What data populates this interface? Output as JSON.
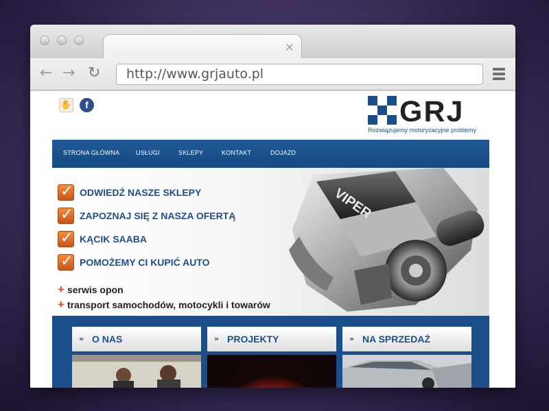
{
  "browser": {
    "tab_close": "×",
    "back": "←",
    "forward": "→",
    "reload": "↻",
    "url": "http://www.grjauto.pl"
  },
  "site": {
    "logo_text": "GRJ",
    "logo_tagline": "Rozwiązujemy motoryzacyjne problemy",
    "social": {
      "hand": "✋",
      "facebook": "f"
    },
    "nav": [
      "STRONA GŁÓWNA",
      "USŁUGI",
      "SKLEPY",
      "KONTAKT",
      "DOJAZD"
    ],
    "hero": {
      "checks": [
        "ODWIEDŹ NASZE SKLEPY",
        "ZAPOZNAJ SIĘ Z NASZA OFERTĄ",
        "KĄCIK SAABA",
        "POMOŻEMY CI KUPIĆ AUTO"
      ],
      "check_mark": "✓",
      "plus_mark": "+",
      "extras": [
        "serwis opon",
        "transport samochodów, motocykli i towarów"
      ],
      "engine_label": "VIPER"
    },
    "boxes": [
      {
        "title": "O NAS",
        "arrows": "»"
      },
      {
        "title": "PROJEKTY",
        "arrows": "»"
      },
      {
        "title": "NA SPRZEDAŻ",
        "arrows": "»"
      }
    ]
  },
  "colors": {
    "brand_blue": "#1b4f8c",
    "accent_orange": "#e06a28"
  }
}
